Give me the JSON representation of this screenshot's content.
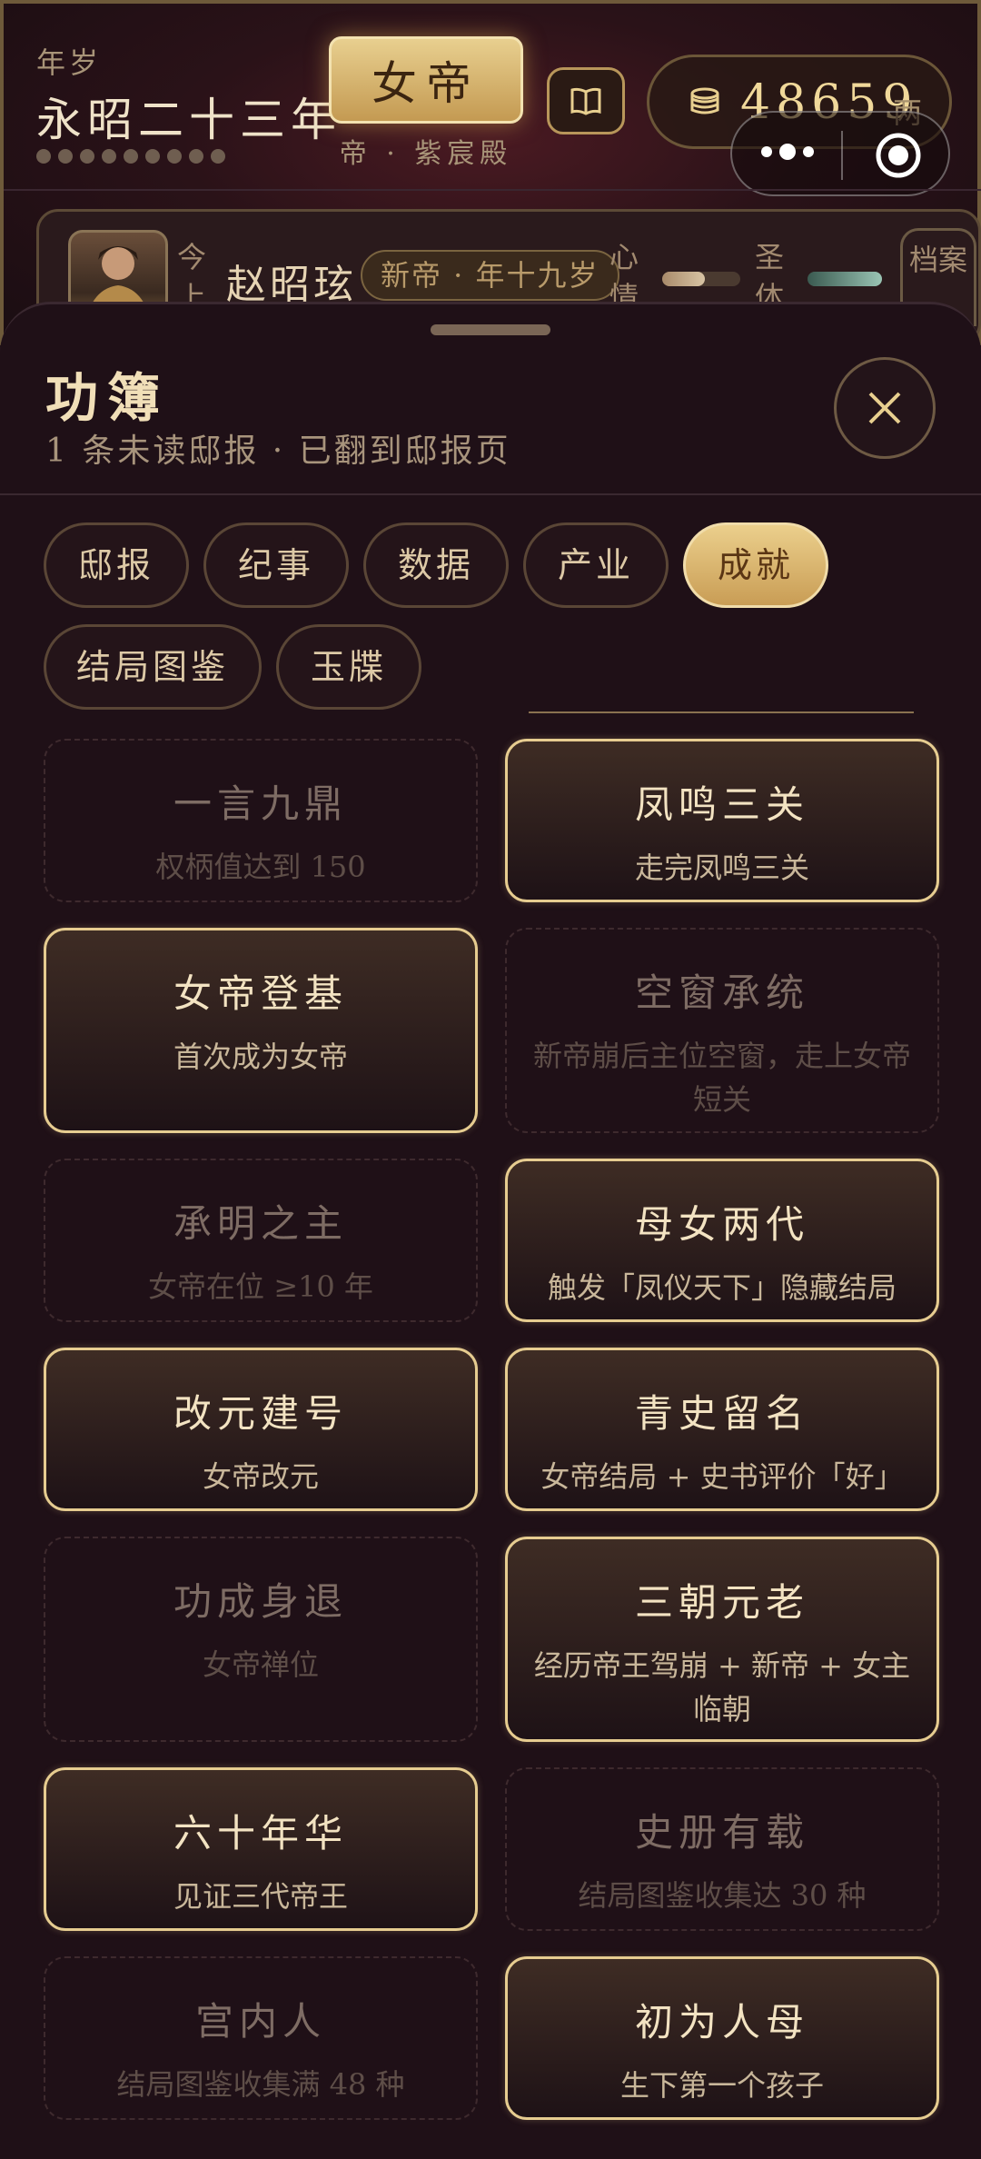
{
  "header": {
    "era_label": "年岁",
    "era_name": "永昭二十三年",
    "title_badge": "女帝",
    "title_sub": "帝 · 紫宸殿",
    "coins": "48659",
    "coin_unit": "两"
  },
  "emperor": {
    "prefix": "今上",
    "name": "赵昭玹",
    "tag": "新帝 · 年十九岁",
    "mood_label": "心情",
    "mood_value": 0.55,
    "health_label": "圣体",
    "health_value": 1.0,
    "dossier_label": "档案"
  },
  "sheet": {
    "title": "功簿",
    "subtitle": "1 条未读邸报 · 已翻到邸报页"
  },
  "tabs": [
    {
      "label": "邸报",
      "active": false
    },
    {
      "label": "纪事",
      "active": false
    },
    {
      "label": "数据",
      "active": false
    },
    {
      "label": "产业",
      "active": false
    },
    {
      "label": "成就",
      "active": true
    },
    {
      "label": "结局图鉴",
      "active": false
    },
    {
      "label": "玉牒",
      "active": false
    }
  ],
  "achievements": [
    {
      "title": "一言九鼎",
      "desc": "权柄值达到 150",
      "unlocked": false
    },
    {
      "title": "凤鸣三关",
      "desc": "走完凤鸣三关",
      "unlocked": true
    },
    {
      "title": "女帝登基",
      "desc": "首次成为女帝",
      "unlocked": true
    },
    {
      "title": "空窗承统",
      "desc": "新帝崩后主位空窗，走上女帝短关",
      "unlocked": false
    },
    {
      "title": "承明之主",
      "desc": "女帝在位 ≥10 年",
      "unlocked": false
    },
    {
      "title": "母女两代",
      "desc": "触发「凤仪天下」隐藏结局",
      "unlocked": true
    },
    {
      "title": "改元建号",
      "desc": "女帝改元",
      "unlocked": true
    },
    {
      "title": "青史留名",
      "desc": "女帝结局 + 史书评价「好」",
      "unlocked": true
    },
    {
      "title": "功成身退",
      "desc": "女帝禅位",
      "unlocked": false
    },
    {
      "title": "三朝元老",
      "desc": "经历帝王驾崩 + 新帝 + 女主临朝",
      "unlocked": true
    },
    {
      "title": "六十年华",
      "desc": "见证三代帝王",
      "unlocked": true
    },
    {
      "title": "史册有载",
      "desc": "结局图鉴收集达 30 种",
      "unlocked": false
    },
    {
      "title": "宫内人",
      "desc": "结局图鉴收集满 48 种",
      "unlocked": false
    },
    {
      "title": "初为人母",
      "desc": "生下第一个孩子",
      "unlocked": true
    }
  ],
  "colors": {
    "accent_gold": "#e6cc90",
    "background": "#1f1017"
  },
  "icons": {
    "book": "book-icon",
    "coins": "coins-icon",
    "close": "close-icon",
    "more": "more-icon",
    "target": "target-icon"
  }
}
